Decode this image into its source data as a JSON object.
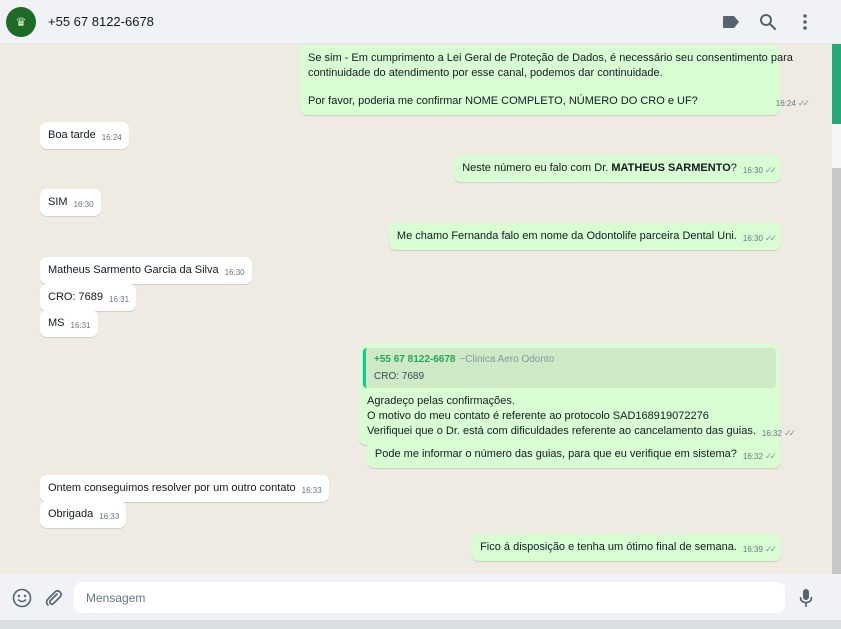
{
  "header": {
    "contact_name": "+55 67 8122-6678",
    "avatar_icon": "tooth-logo-icon",
    "icons": [
      "label-icon",
      "search-icon",
      "menu-icon"
    ]
  },
  "messages": [
    {
      "dir": "out",
      "lines": [
        "Se sim - Em cumprimento a Lei Geral de Proteção de Dados, é necessário seu consentimento para",
        "continuidade do atendimento por esse canal, podemos dar continuidade.",
        "",
        "Por favor, poderia me confirmar NOME COMPLETO, NÚMERO DO CRO e UF?"
      ],
      "time": "16:24"
    },
    {
      "dir": "in",
      "text": "Boa tarde",
      "time": "16:24"
    },
    {
      "dir": "out",
      "text_pre": "Neste número eu falo com Dr. ",
      "text_bold": "MATHEUS SARMENTO",
      "text_post": "?",
      "time": "16:30"
    },
    {
      "dir": "in",
      "text": "SIM",
      "time": "16:30"
    },
    {
      "dir": "out",
      "text": "Me chamo Fernanda falo em nome da Odontolife parceira Dental Uni.",
      "time": "16:30"
    },
    {
      "dir": "in",
      "text": "Matheus Sarmento Garcia da Silva",
      "time": "16:30"
    },
    {
      "dir": "in",
      "text": "CRO: 7689",
      "time": "16:31"
    },
    {
      "dir": "in",
      "text": "MS",
      "time": "16:31"
    },
    {
      "dir": "out",
      "quote": {
        "author": "+55 67 8122-6678",
        "pushname": "~Clinica Aero Odonto",
        "text": "CRO: 7689"
      },
      "lines": [
        "Agradeço pelas confirmações.",
        "O motivo do meu contato é referente ao protocolo SAD168919072276",
        "Verifiquei que o Dr. está com dificuldades referente ao cancelamento das guias."
      ],
      "time": "16:32"
    },
    {
      "dir": "out",
      "text": "Pode me informar o número das guias, para que eu verifique em sistema?",
      "time": "16:32"
    },
    {
      "dir": "in",
      "text": "Ontem conseguimos resolver por um outro contato",
      "time": "16:33"
    },
    {
      "dir": "in",
      "text": "Obrigada",
      "time": "16:33"
    },
    {
      "dir": "out",
      "text": "Fico á disposição e tenha um ótimo final de semana.",
      "time": "16:39"
    }
  ],
  "composer": {
    "placeholder": "Mensagem",
    "icons": [
      "emoji-icon",
      "attach-icon",
      "microphone-icon"
    ]
  },
  "colors": {
    "outgoing_bubble": "#d9fdd3",
    "incoming_bubble": "#ffffff",
    "chat_background": "#efeae2",
    "quote_author": "#1fa855",
    "accent": "#25a97a"
  }
}
